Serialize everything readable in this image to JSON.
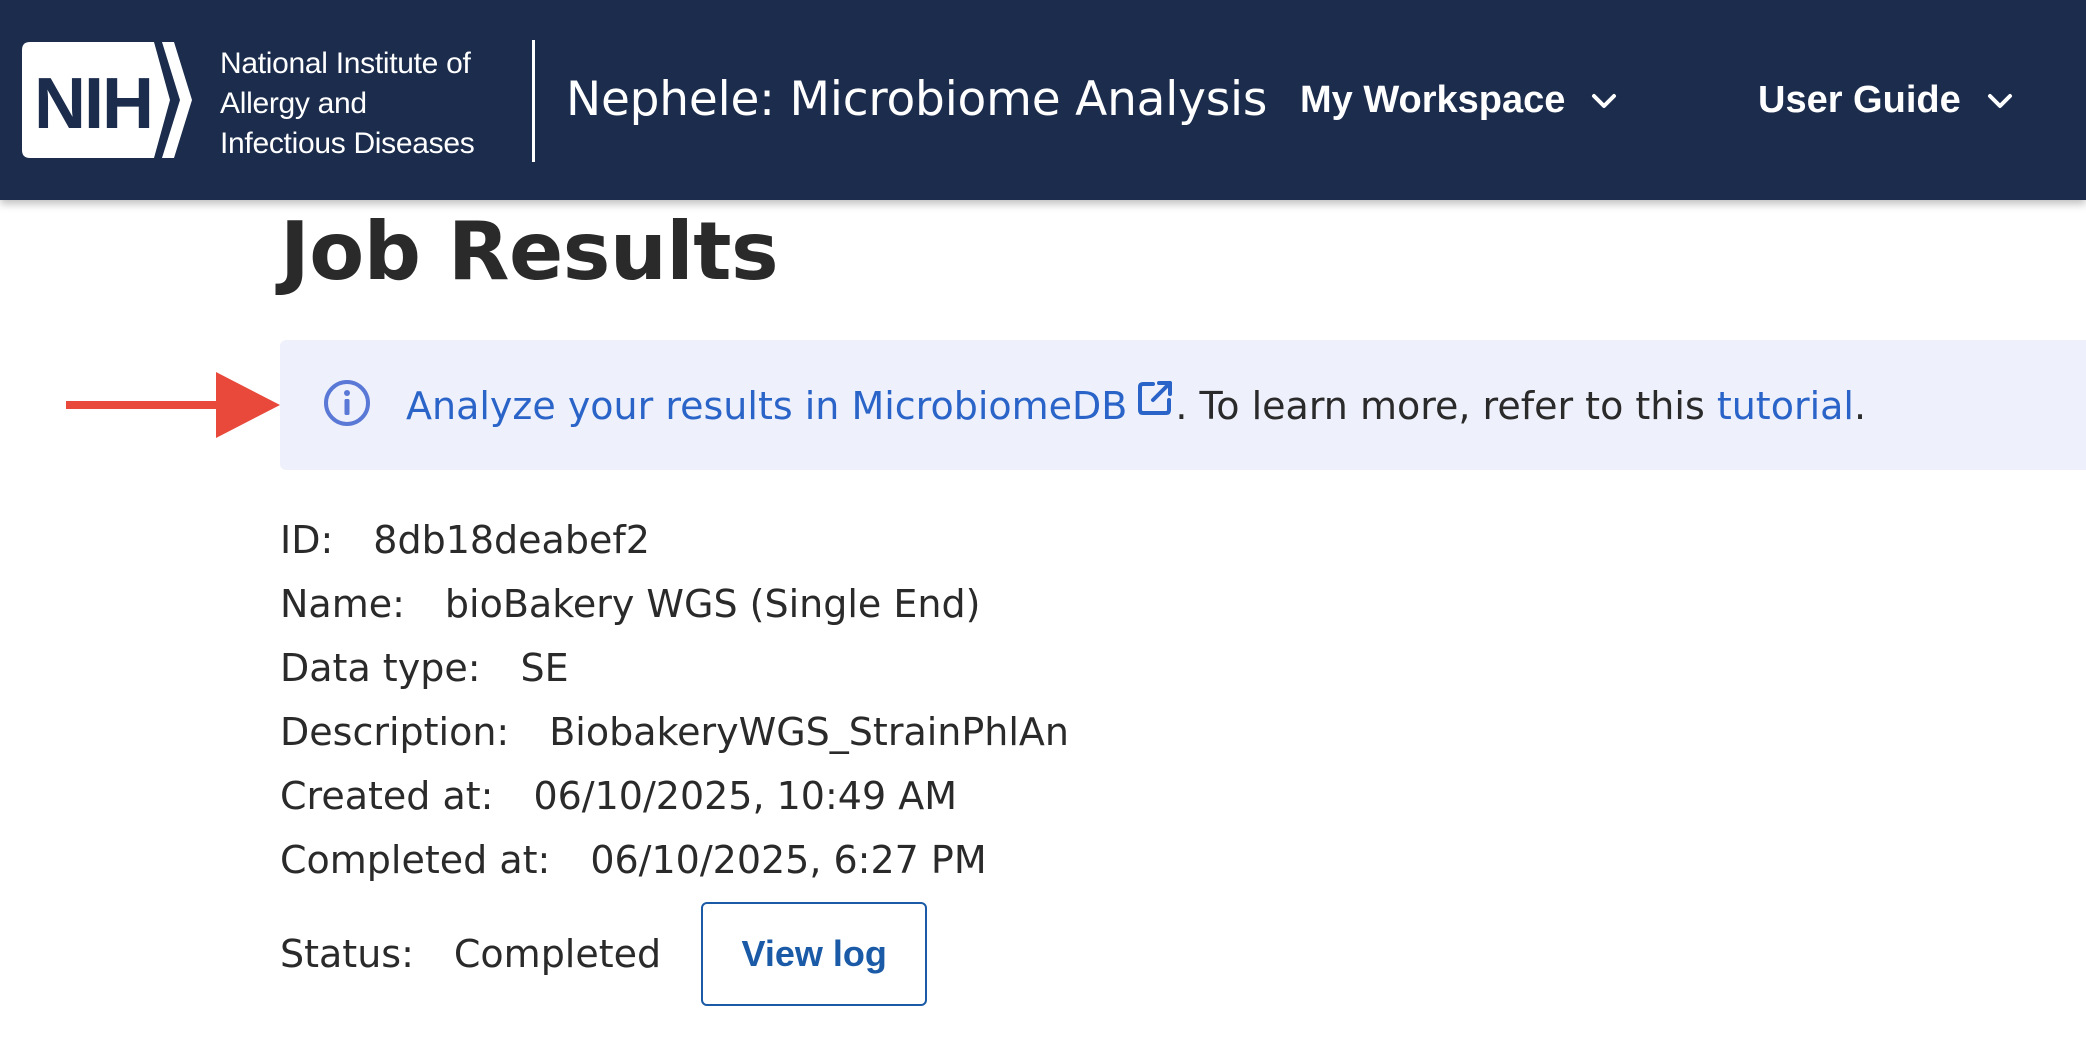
{
  "header": {
    "logo_mark": "NIH",
    "org_lines": [
      "National Institute of",
      "Allergy and",
      "Infectious Diseases"
    ],
    "app_title": "Nephele: Microbiome Analysis",
    "nav": [
      {
        "label": "My Workspace",
        "icon": "chevron-down-icon"
      },
      {
        "label": "User Guide",
        "icon": "chevron-down-icon"
      }
    ]
  },
  "page": {
    "title": "Job Results"
  },
  "alert": {
    "icon": "info-icon",
    "link_text": "Analyze your results in MicrobiomeDB",
    "link_icon": "external-link-icon",
    "middle_text": ". To learn more, refer to this ",
    "tutorial_text": "tutorial",
    "end_text": "."
  },
  "job": {
    "fields": [
      {
        "label": "ID:",
        "value": "8db18deabef2"
      },
      {
        "label": "Name:",
        "value": "bioBakery WGS (Single End)"
      },
      {
        "label": "Data type:",
        "value": "SE"
      },
      {
        "label": "Description:",
        "value": "BiobakeryWGS_StrainPhlAn"
      },
      {
        "label": "Created at:",
        "value": "06/10/2025, 10:49 AM"
      },
      {
        "label": "Completed at:",
        "value": "06/10/2025, 6:27 PM"
      }
    ],
    "status_label": "Status:",
    "status_value": "Completed",
    "view_log_label": "View log"
  },
  "colors": {
    "header_bg": "#1b2c4d",
    "alert_bg": "#eef1fb",
    "link": "#2a64c8",
    "button_accent": "#1a5aa6",
    "arrow": "#e8493b"
  }
}
